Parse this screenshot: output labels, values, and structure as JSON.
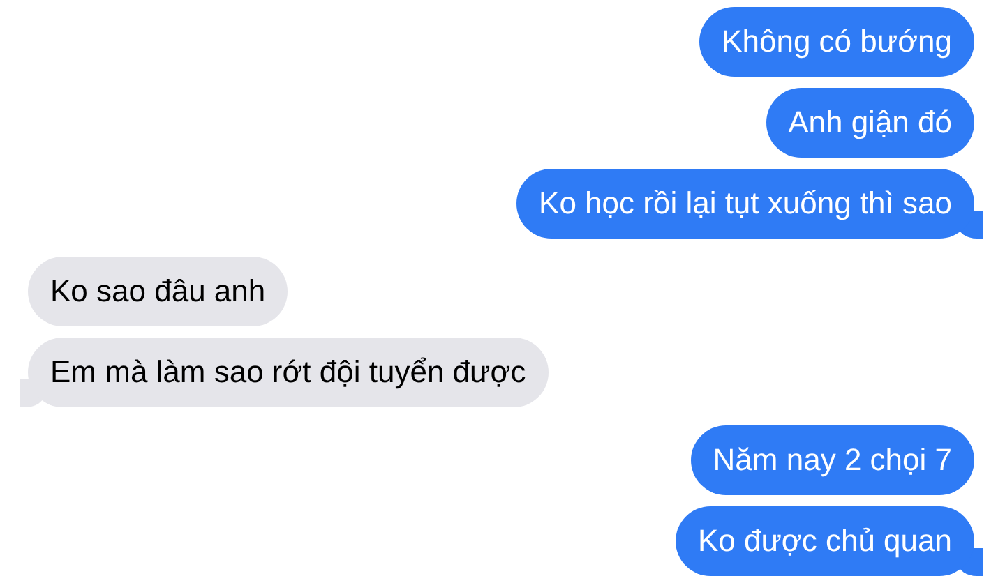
{
  "messages": [
    {
      "text": "Không có bướng",
      "kind": "sent",
      "tail": false
    },
    {
      "text": "Anh giận đó",
      "kind": "sent",
      "tail": false
    },
    {
      "text": "Ko học rồi lại tụt xuống thì sao",
      "kind": "sent",
      "tail": true
    },
    {
      "text": "Ko sao đâu anh",
      "kind": "received",
      "tail": false
    },
    {
      "text": "Em mà làm sao rớt đội tuyển được",
      "kind": "received",
      "tail": true
    },
    {
      "text": "Năm nay 2 chọi 7",
      "kind": "sent",
      "tail": false
    },
    {
      "text": "Ko được chủ quan",
      "kind": "sent",
      "tail": true
    }
  ]
}
